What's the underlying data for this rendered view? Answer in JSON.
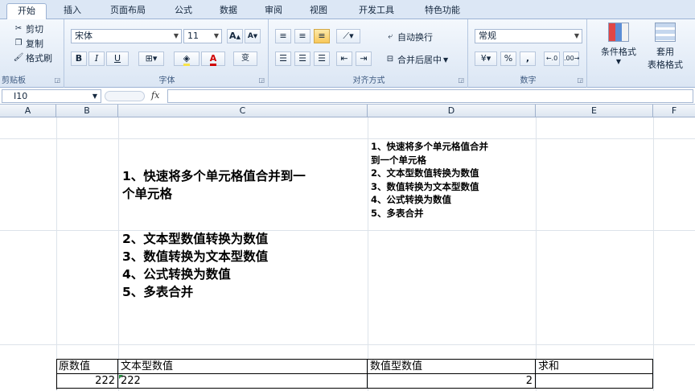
{
  "tabs": [
    "开始",
    "插入",
    "页面布局",
    "公式",
    "数据",
    "审阅",
    "视图",
    "开发工具",
    "特色功能"
  ],
  "clipboard": {
    "cut": "剪切",
    "copy": "复制",
    "painter": "格式刷",
    "label": "剪贴板"
  },
  "font": {
    "name": "宋体",
    "size": "11",
    "label": "字体",
    "bold": "B",
    "italic": "I",
    "underline": "U",
    "color_glyph": "A",
    "grow": "A",
    "shrink": "A",
    "wen": "变"
  },
  "align": {
    "wrap": "自动换行",
    "merge": "合并后居中",
    "label": "对齐方式"
  },
  "number": {
    "format": "常规",
    "percent": "%",
    "comma": ",",
    "label": "数字"
  },
  "styles": {
    "cond": "条件格式",
    "table_line1": "套用",
    "table_line2": "表格格式"
  },
  "formula_bar": {
    "cell_ref": "I10",
    "fx": "fx",
    "value": ""
  },
  "columns": [
    "A",
    "B",
    "C",
    "D",
    "E",
    "F"
  ],
  "cell_c": {
    "line1": "1、快速将多个单元格值合并到一",
    "line2": "个单元格",
    "items": [
      "2、文本型数值转换为数值",
      "3、数值转换为文本型数值",
      "4、公式转换为数值",
      "5、多表合并"
    ]
  },
  "cell_d": {
    "lines": [
      "1、快速将多个单元格值合并",
      "到一个单元格",
      "2、文本型数值转换为数值",
      "3、数值转换为文本型数值",
      "4、公式转换为数值",
      "5、多表合并"
    ]
  },
  "table": {
    "headers": [
      "原数值",
      "文本型数值",
      "数值型数值",
      "求和"
    ],
    "row": [
      "222",
      "222",
      "2",
      ""
    ]
  },
  "colors": {
    "accent": "#dce7f5",
    "highlight": "#f8c85a",
    "font_red": "#d00000"
  }
}
